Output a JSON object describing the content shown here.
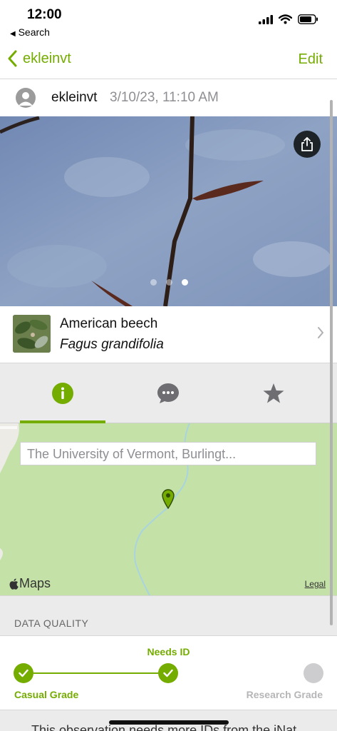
{
  "status_bar": {
    "time": "12:00",
    "back_label": "Search"
  },
  "nav": {
    "back_label": "ekleinvt",
    "edit_label": "Edit"
  },
  "observer": {
    "name": "ekleinvt",
    "date": "3/10/23, 11:10 AM"
  },
  "photo": {
    "pages": 3,
    "active_page": 3
  },
  "taxon": {
    "common_name": "American beech",
    "scientific_name": "Fagus grandifolia"
  },
  "tabs": [
    {
      "icon": "info-icon",
      "selected": true
    },
    {
      "icon": "comments-icon",
      "selected": false
    },
    {
      "icon": "star-icon",
      "selected": false
    }
  ],
  "map": {
    "place": "The University of Vermont, Burlingt...",
    "provider": "Maps",
    "legal": "Legal"
  },
  "data_quality": {
    "title": "DATA QUALITY",
    "casual": "Casual Grade",
    "needs_id": "Needs ID",
    "research": "Research Grade",
    "accent": "#74ac00",
    "inactive": "#cdcdcf"
  },
  "footer": {
    "text": "This observation needs more IDs from the iNat"
  }
}
